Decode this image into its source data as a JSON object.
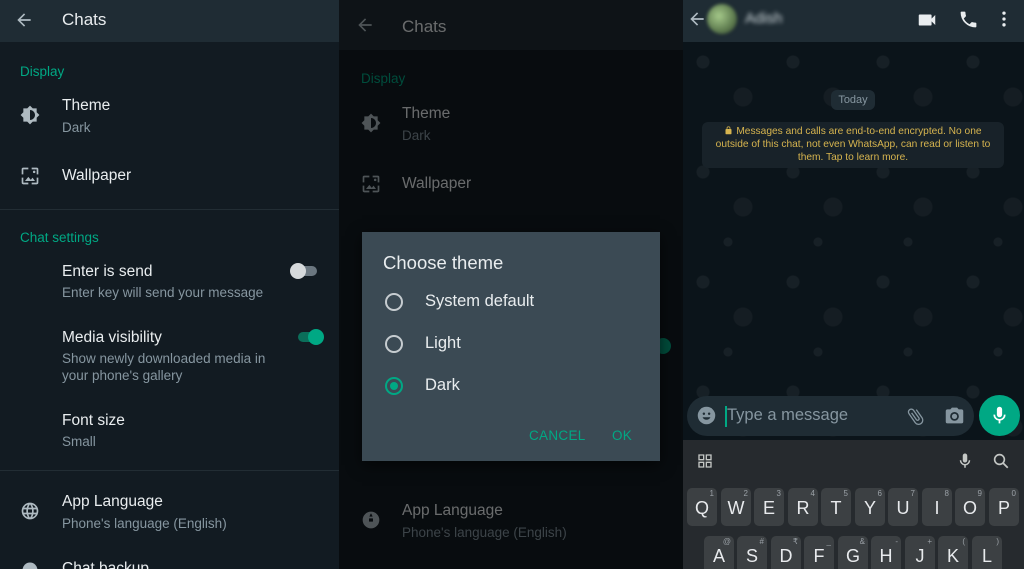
{
  "settings": {
    "title": "Chats",
    "display_section": "Display",
    "theme": {
      "title": "Theme",
      "value": "Dark"
    },
    "wallpaper": {
      "title": "Wallpaper"
    },
    "chat_settings_section": "Chat settings",
    "enter_is_send": {
      "title": "Enter is send",
      "subtitle": "Enter key will send your message",
      "enabled": false
    },
    "media_visibility": {
      "title": "Media visibility",
      "subtitle_line1": "Show newly downloaded media in",
      "subtitle_line2": "your phone's gallery",
      "enabled": true
    },
    "font_size": {
      "title": "Font size",
      "value": "Small"
    },
    "app_language": {
      "title": "App Language",
      "value": "Phone's language (English)"
    },
    "chat_backup": {
      "title": "Chat backup"
    }
  },
  "theme_dialog": {
    "title": "Choose theme",
    "options": [
      {
        "label": "System default",
        "selected": false
      },
      {
        "label": "Light",
        "selected": false
      },
      {
        "label": "Dark",
        "selected": true
      }
    ],
    "cancel": "CANCEL",
    "ok": "OK"
  },
  "chat": {
    "contact_name": "Adish",
    "date_chip": "Today",
    "encryption_notice": "Messages and calls are end-to-end encrypted. No one outside of this chat, not even WhatsApp, can read or listen to them. Tap to learn more.",
    "input_placeholder": "Type a message",
    "icons": [
      "back-arrow-icon",
      "video-call-icon",
      "phone-icon",
      "more-options-icon",
      "emoji-icon",
      "attach-icon",
      "camera-icon",
      "mic-icon",
      "lock-icon"
    ]
  },
  "keyboard": {
    "row1": [
      {
        "key": "Q",
        "hint": "1"
      },
      {
        "key": "W",
        "hint": "2"
      },
      {
        "key": "E",
        "hint": "3"
      },
      {
        "key": "R",
        "hint": "4"
      },
      {
        "key": "T",
        "hint": "5"
      },
      {
        "key": "Y",
        "hint": "6"
      },
      {
        "key": "U",
        "hint": "7"
      },
      {
        "key": "I",
        "hint": "8"
      },
      {
        "key": "O",
        "hint": "9"
      },
      {
        "key": "P",
        "hint": "0"
      }
    ],
    "row2": [
      {
        "key": "A",
        "hint": "@"
      },
      {
        "key": "S",
        "hint": "#"
      },
      {
        "key": "D",
        "hint": "₹"
      },
      {
        "key": "F",
        "hint": "_"
      },
      {
        "key": "G",
        "hint": "&"
      },
      {
        "key": "H",
        "hint": "-"
      },
      {
        "key": "J",
        "hint": "+"
      },
      {
        "key": "K",
        "hint": "("
      },
      {
        "key": "L",
        "hint": ")"
      }
    ]
  },
  "colors": {
    "accent": "#00a884",
    "header": "#1f2c34",
    "background": "#121b22",
    "text_primary": "#e9edef",
    "text_secondary": "#8696a0"
  }
}
